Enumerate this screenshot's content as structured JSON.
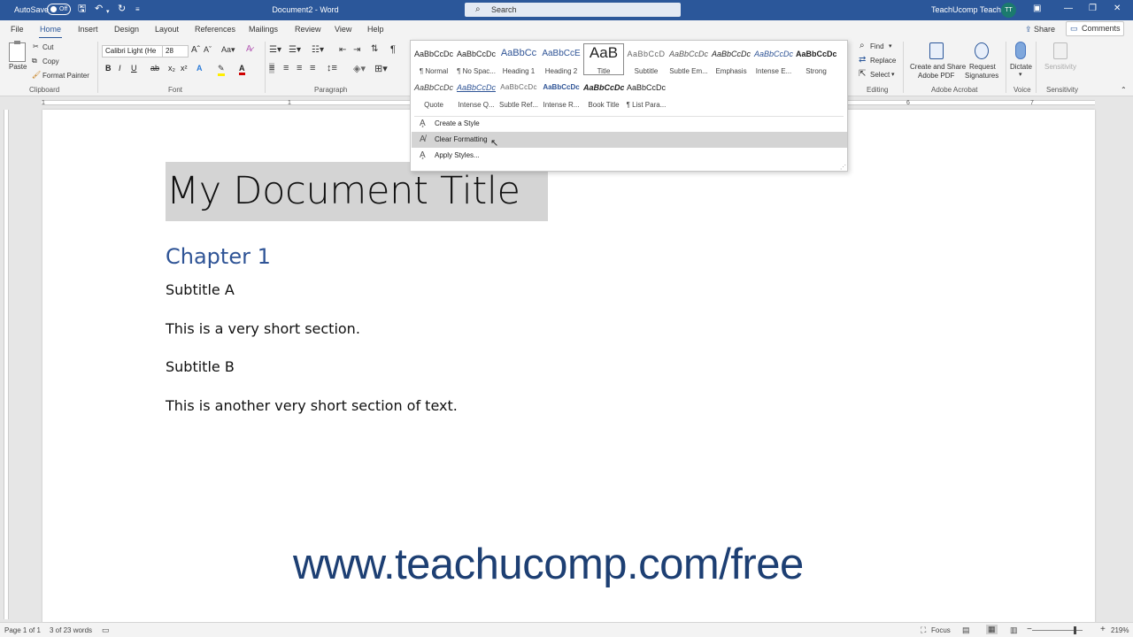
{
  "titlebar": {
    "autosave_label": "AutoSave",
    "autosave_state": "Off",
    "document_title": "Document2 - Word",
    "search_placeholder": "Search",
    "user_name": "TeachUcomp Teacher",
    "user_initials": "TT"
  },
  "tabs": [
    "File",
    "Home",
    "Insert",
    "Design",
    "Layout",
    "References",
    "Mailings",
    "Review",
    "View",
    "Help"
  ],
  "active_tab": "Home",
  "share_label": "Share",
  "comments_label": "Comments",
  "ribbon": {
    "clipboard": {
      "paste": "Paste",
      "cut": "Cut",
      "copy": "Copy",
      "format_painter": "Format Painter",
      "label": "Clipboard"
    },
    "font": {
      "name": "Calibri Light (He",
      "size": "28",
      "label": "Font"
    },
    "paragraph_label": "Paragraph",
    "editing": {
      "find": "Find",
      "replace": "Replace",
      "select": "Select",
      "label": "Editing"
    },
    "acrobat": {
      "create_share": "Create and Share",
      "adobe_pdf": "Adobe PDF",
      "request": "Request",
      "signatures": "Signatures",
      "label": "Adobe Acrobat"
    },
    "voice": {
      "dictate": "Dictate",
      "label": "Voice"
    },
    "sensitivity": {
      "button": "Sensitivity",
      "label": "Sensitivity"
    }
  },
  "styles_gallery": {
    "row1": [
      {
        "sample": "AaBbCcDc",
        "name": "¶ Normal"
      },
      {
        "sample": "AaBbCcDc",
        "name": "¶ No Spac..."
      },
      {
        "sample": "AaBbCc",
        "name": "Heading 1"
      },
      {
        "sample": "AaBbCcE",
        "name": "Heading 2"
      },
      {
        "sample": "AaB",
        "name": "Title"
      },
      {
        "sample": "AaBbCcD",
        "name": "Subtitle"
      },
      {
        "sample": "AaBbCcDc",
        "name": "Subtle Em..."
      },
      {
        "sample": "AaBbCcDc",
        "name": "Emphasis"
      },
      {
        "sample": "AaBbCcDc",
        "name": "Intense E..."
      },
      {
        "sample": "AaBbCcDc",
        "name": "Strong"
      }
    ],
    "row2": [
      {
        "sample": "AaBbCcDc",
        "name": "Quote"
      },
      {
        "sample": "AaBbCcDc",
        "name": "Intense Q..."
      },
      {
        "sample": "AaBbCcDc",
        "name": "Subtle Ref..."
      },
      {
        "sample": "AaBbCcDc",
        "name": "Intense R..."
      },
      {
        "sample": "AaBbCcDc",
        "name": "Book Title"
      },
      {
        "sample": "AaBbCcDc",
        "name": "¶ List Para..."
      }
    ],
    "menu": [
      "Create a Style",
      "Clear Formatting",
      "Apply Styles..."
    ]
  },
  "ruler_numbers": [
    "1",
    "1",
    "6",
    "7"
  ],
  "document": {
    "title": "My Document Title",
    "chapter": "Chapter 1",
    "subtitle_a": "Subtitle A",
    "section_a": "This is a very short section.",
    "subtitle_b": "Subtitle B",
    "section_b": "This is another very short section of text.",
    "watermark": "www.teachucomp.com/free"
  },
  "statusbar": {
    "page": "Page 1 of 1",
    "words": "3 of 23 words",
    "focus": "Focus",
    "zoom": "219%"
  }
}
